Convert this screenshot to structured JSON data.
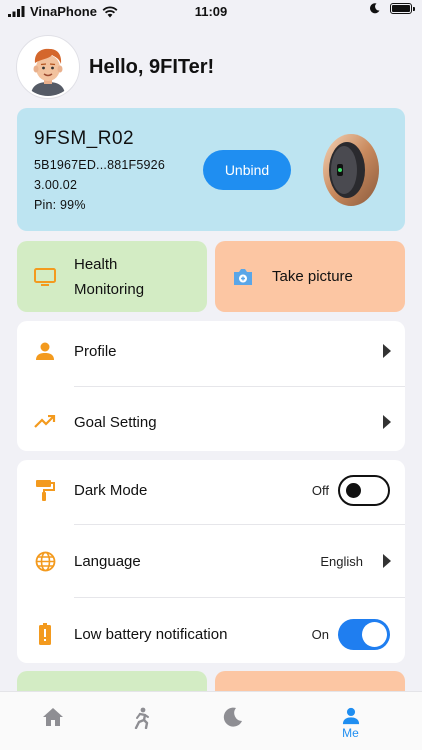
{
  "status_bar": {
    "carrier": "VinaPhone",
    "time": "11:09"
  },
  "header": {
    "greeting": "Hello, 9FITer!"
  },
  "device": {
    "name": "9FSM_R02",
    "id": "5B1967ED...881F5926",
    "version": "3.00.02",
    "battery": "Pin: 99%",
    "unbind_label": "Unbind"
  },
  "tiles": [
    {
      "line1": "Health",
      "line2": "Monitoring",
      "icon": "monitor-icon"
    },
    {
      "label": "Take picture",
      "icon": "camera-icon"
    }
  ],
  "menu": {
    "profile": "Profile",
    "goal_setting": "Goal Setting",
    "dark_mode": "Dark Mode",
    "dark_mode_value": "Off",
    "language": "Language",
    "language_value": "English",
    "low_battery": "Low battery notification",
    "low_battery_value": "On"
  },
  "toggles": {
    "dark_mode_on": false,
    "low_battery_on": true
  },
  "tabbar": {
    "active_label": "Me"
  },
  "colors": {
    "accent": "#1f8ef1",
    "device_card": "#bde4f1",
    "tile_green": "#d3ecc4",
    "tile_orange": "#fcc6a3",
    "icon_orange": "#f39a1e"
  }
}
